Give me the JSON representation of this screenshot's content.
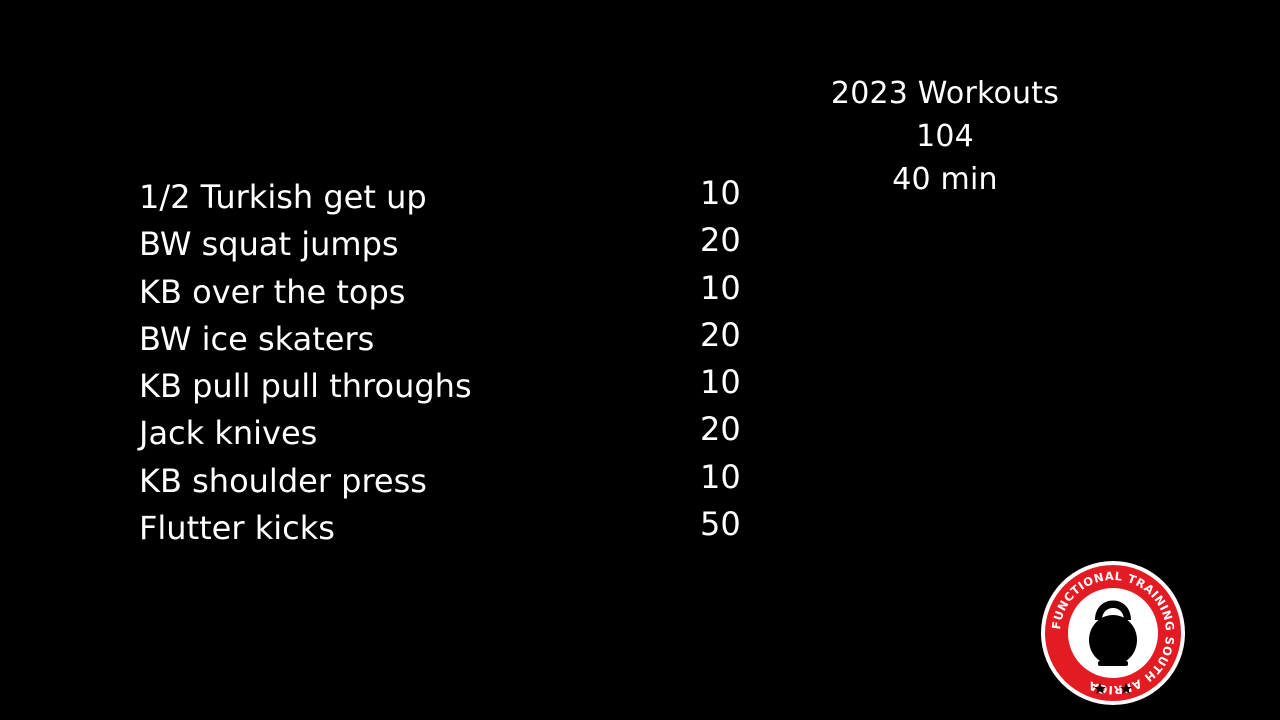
{
  "header": {
    "title": "2023 Workouts",
    "workout_number": "104",
    "duration": "40 min"
  },
  "exercises": [
    {
      "name": "1/2 Turkish get up",
      "reps": "10"
    },
    {
      "name": "BW squat jumps",
      "reps": "20"
    },
    {
      "name": "KB over the tops",
      "reps": "10"
    },
    {
      "name": "BW ice skaters",
      "reps": "20"
    },
    {
      "name": "KB pull pull throughs",
      "reps": "10"
    },
    {
      "name": "Jack knives",
      "reps": "20"
    },
    {
      "name": "KB shoulder press",
      "reps": "10"
    },
    {
      "name": "Flutter kicks",
      "reps": "50"
    }
  ],
  "logo": {
    "text": "FUNCTIONAL TRAINING SOUTH AFRICA",
    "icon": "kettlebell-icon",
    "colors": {
      "ring": "#e31b23",
      "inner": "#ffffff",
      "mark": "#000000"
    }
  },
  "colors": {
    "background": "#000000",
    "text": "#ffffff"
  }
}
